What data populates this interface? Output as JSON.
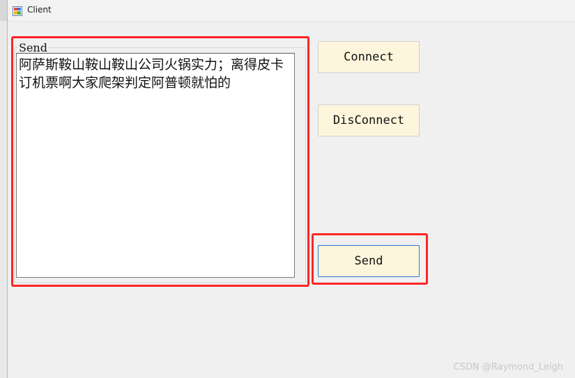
{
  "window": {
    "title": "Client"
  },
  "group": {
    "label": "Send"
  },
  "textbox": {
    "value": "阿萨斯鞍山鞍山鞍山公司火锅实力；离得皮卡订机票啊大家爬架判定阿普顿就怕的"
  },
  "buttons": {
    "connect": "Connect",
    "disconnect": "DisConnect",
    "send": "Send"
  },
  "watermark": "CSDN @Raymond_Leigh",
  "colors": {
    "button_bg": "#fdf5dc",
    "highlight": "#ff2424",
    "focus_border": "#2b79d4"
  }
}
